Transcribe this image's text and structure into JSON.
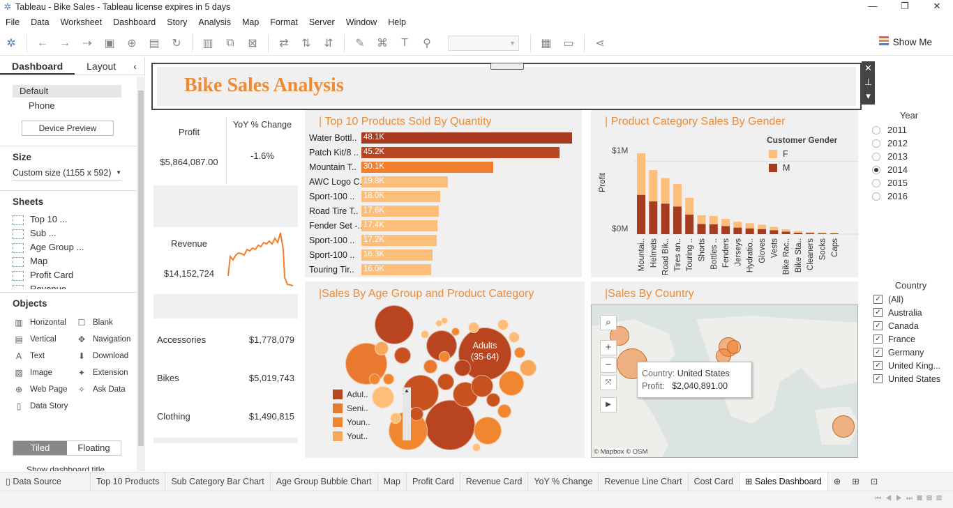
{
  "window": {
    "title": "Tableau - Bike Sales - Tableau license expires in 5 days"
  },
  "menu": [
    "File",
    "Data",
    "Worksheet",
    "Dashboard",
    "Story",
    "Analysis",
    "Map",
    "Format",
    "Server",
    "Window",
    "Help"
  ],
  "toolbar": {
    "show_me": "Show Me"
  },
  "left_pane": {
    "tabs": [
      "Dashboard",
      "Layout"
    ],
    "devices": [
      "Default",
      "Phone"
    ],
    "device_preview": "Device Preview",
    "size_header": "Size",
    "size_value": "Custom size (1155 x 592)",
    "sheets_header": "Sheets",
    "sheets": [
      "Top 10 ...",
      "Sub ...",
      "Age Group ...",
      "Map",
      "Profit Card",
      "Revenue ..."
    ],
    "objects_header": "Objects",
    "objects": [
      "Horizontal",
      "Blank",
      "Vertical",
      "Navigation",
      "Text",
      "Download",
      "Image",
      "Extension",
      "Web Page",
      "Ask Data",
      "Data Story"
    ],
    "layout_toggle": [
      "Tiled",
      "Floating"
    ],
    "cutoff_label": "Show dashboard title"
  },
  "dashboard": {
    "title": "Bike Sales Analysis",
    "profit_label": "Profit",
    "profit_value": "$5,864,087.00",
    "yoy_label": "YoY % Change",
    "yoy_value": "-1.6%",
    "revenue_label": "Revenue",
    "revenue_value": "$14,152,724",
    "categories": [
      {
        "name": "Accessories",
        "value": "$1,778,079"
      },
      {
        "name": "Bikes",
        "value": "$5,019,743"
      },
      {
        "name": "Clothing",
        "value": "$1,490,815"
      }
    ],
    "top10_title": "| Top 10 Products Sold By Quantity",
    "gender_title": "| Product Category Sales By Gender",
    "gender_legend_title": "Customer Gender",
    "gender_legend": [
      "F",
      "M"
    ],
    "gender_ylabel": "Profit",
    "gender_yticks": [
      "$1M",
      "$0M"
    ],
    "age_title": "|Sales By Age Group and Product Category",
    "age_legend": [
      "Adul..",
      "Seni..",
      "Youn..",
      "Yout.."
    ],
    "bubble_label": [
      "Adults",
      "(35-64)"
    ],
    "country_title": "|Sales By Country",
    "tooltip": {
      "country_label": "Country:",
      "country": "United States",
      "profit_label": "Profit:",
      "profit": "$2,040,891.00"
    },
    "attribution": "© Mapbox © OSM",
    "year_filter_title": "Year",
    "years": [
      "2011",
      "2012",
      "2013",
      "2014",
      "2015",
      "2016"
    ],
    "selected_year": "2014",
    "country_filter_title": "Country",
    "countries": [
      "(All)",
      "Australia",
      "Canada",
      "France",
      "Germany",
      "United King...",
      "United States"
    ]
  },
  "chart_data": [
    {
      "type": "bar",
      "title": "| Top 10 Products Sold By Quantity",
      "categories": [
        "Water Bottl..",
        "Patch Kit/8 ..",
        "Mountain T..",
        "AWC Logo C..",
        "Sport-100 ..",
        "Road Tire T..",
        "Fender Set -..",
        "Sport-100 ..",
        "Sport-100 ..",
        "Touring Tir.."
      ],
      "values": [
        48100,
        45200,
        30100,
        19800,
        18000,
        17600,
        17400,
        17200,
        16300,
        16000
      ],
      "value_labels": [
        "48.1K",
        "45.2K",
        "30.1K",
        "19.8K",
        "18.0K",
        "17.6K",
        "17.4K",
        "17.2K",
        "16.3K",
        "16.0K"
      ],
      "colors": [
        "#a63b1f",
        "#b8451f",
        "#f07e2c",
        "#fdbe7a",
        "#fdbe7a",
        "#fdbe7a",
        "#fdbe7a",
        "#fdbe7a",
        "#fdbe7a",
        "#fdbe7a"
      ]
    },
    {
      "type": "bar",
      "title": "| Product Category Sales By Gender",
      "ylabel": "Profit",
      "categories": [
        "Mountai..",
        "Helmets",
        "Road Bik..",
        "Tires an..",
        "Touring ..",
        "Shorts",
        "Bottles ..",
        "Fenders",
        "Jerseys",
        "Hydratio..",
        "Gloves",
        "Vests",
        "Bike Rac..",
        "Bike Sta..",
        "Cleaners",
        "Socks",
        "Caps"
      ],
      "series": [
        {
          "name": "M",
          "values": [
            540000,
            450000,
            420000,
            380000,
            270000,
            140000,
            135000,
            110000,
            90000,
            80000,
            70000,
            55000,
            35000,
            20000,
            15000,
            12000,
            10000
          ]
        },
        {
          "name": "F",
          "values": [
            570000,
            430000,
            350000,
            310000,
            230000,
            120000,
            115000,
            100000,
            80000,
            70000,
            60000,
            45000,
            30000,
            18000,
            12000,
            10000,
            8000
          ]
        }
      ],
      "colors": {
        "M": "#a63b1f",
        "F": "#fdbe7a"
      },
      "ylim": [
        0,
        1150000
      ]
    }
  ]
}
